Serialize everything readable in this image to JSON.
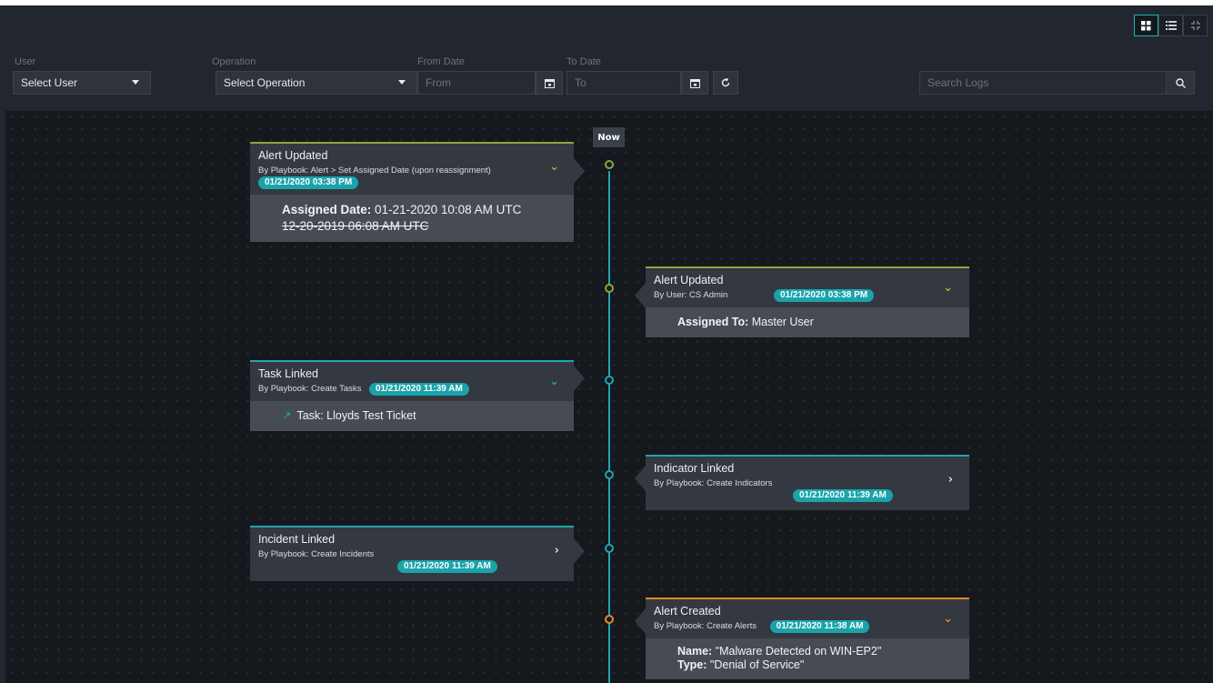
{
  "filters": {
    "user_label": "User",
    "user_value": "Select User",
    "operation_label": "Operation",
    "operation_value": "Select Operation",
    "from_label": "From Date",
    "from_placeholder": "From",
    "to_label": "To Date",
    "to_placeholder": "To",
    "search_placeholder": "Search Logs"
  },
  "timeline": {
    "now_label": "Now",
    "events": [
      {
        "title": "Alert Updated",
        "by": "By Playbook: Alert > Set Assigned Date (upon reassignment)",
        "timestamp": "01/21/2020 03:38 PM",
        "body_label": "Assigned Date:",
        "body_value": "01-21-2020 10:08 AM UTC",
        "body_old": "12-20-2019 06:08 AM UTC",
        "side": "left",
        "color": "#8aa83c",
        "expanded": true
      },
      {
        "title": "Alert Updated",
        "by": "By User: CS Admin",
        "timestamp": "01/21/2020 03:38 PM",
        "body_label": "Assigned To:",
        "body_value": "Master User",
        "side": "right",
        "color": "#8aa83c",
        "expanded": true
      },
      {
        "title": "Task Linked",
        "by": "By Playbook: Create Tasks",
        "timestamp": "01/21/2020 11:39 AM",
        "body_value": "Task: Lloyds Test Ticket",
        "side": "left",
        "color": "#1fa6ad",
        "expanded": true
      },
      {
        "title": "Indicator Linked",
        "by": "By Playbook: Create Indicators",
        "timestamp": "01/21/2020 11:39 AM",
        "side": "right",
        "color": "#1fa6ad",
        "expanded": false
      },
      {
        "title": "Incident Linked",
        "by": "By Playbook: Create Incidents",
        "timestamp": "01/21/2020 11:39 AM",
        "side": "left",
        "color": "#1fa6ad",
        "expanded": false
      },
      {
        "title": "Alert Created",
        "by": "By Playbook: Create Alerts",
        "timestamp": "01/21/2020 11:38 AM",
        "body_name_label": "Name:",
        "body_name_value": "\"Malware Detected on WIN-EP2\"",
        "body_type_label": "Type:",
        "body_type_value": "\"Denial of Service\"",
        "side": "right",
        "color": "#e08a24",
        "expanded": true
      }
    ]
  }
}
